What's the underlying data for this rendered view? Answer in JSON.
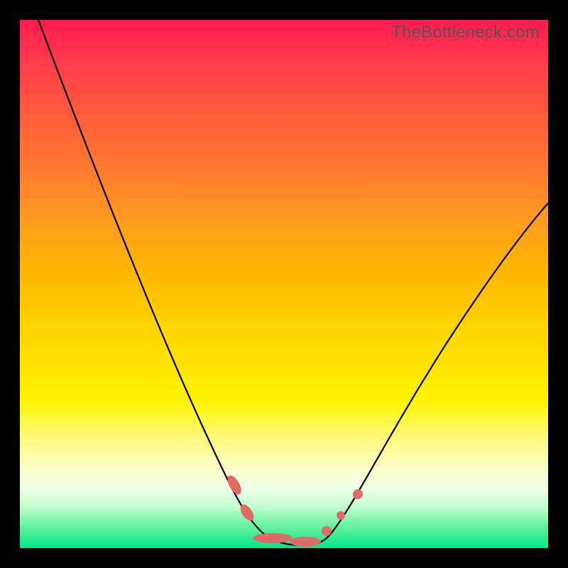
{
  "watermark": "TheBottleneck.com",
  "colors": {
    "frame_bg": "#000000",
    "gradient_top": "#ff1a4d",
    "gradient_mid": "#ffd400",
    "gradient_bottom": "#00e789",
    "curve_stroke": "#000000",
    "marker_fill": "#e06a66"
  },
  "chart_data": {
    "type": "line",
    "title": "",
    "xlabel": "",
    "ylabel": "",
    "xlim": [
      0,
      100
    ],
    "ylim": [
      0,
      100
    ],
    "grid": false,
    "x": [
      3,
      8,
      13,
      18,
      23,
      28,
      33,
      38,
      41,
      44,
      46,
      48,
      50,
      52,
      54,
      56,
      58,
      61,
      64,
      70,
      76,
      82,
      88,
      94,
      99
    ],
    "values": [
      100,
      88,
      76,
      64,
      52,
      40,
      28,
      17,
      11,
      6,
      3,
      1.5,
      1,
      1,
      1,
      1.5,
      3,
      6,
      10,
      20,
      30,
      40,
      49,
      58,
      65
    ],
    "markers": [
      {
        "x": 41,
        "y": 11,
        "shape": "pill-diag",
        "rx": 15,
        "ry": 6,
        "angle": 60
      },
      {
        "x": 44,
        "y": 6,
        "shape": "pill-diag",
        "rx": 13,
        "ry": 6,
        "angle": 55
      },
      {
        "x": 48,
        "y": 1.5,
        "shape": "pill-horiz",
        "rx": 28,
        "ry": 6,
        "angle": 0
      },
      {
        "x": 54,
        "y": 1,
        "shape": "pill-horiz",
        "rx": 22,
        "ry": 6,
        "angle": 0
      },
      {
        "x": 58,
        "y": 3,
        "shape": "dot",
        "rx": 7,
        "ry": 7,
        "angle": 0
      },
      {
        "x": 61,
        "y": 6,
        "shape": "dot",
        "rx": 6,
        "ry": 6,
        "angle": 0
      },
      {
        "x": 64,
        "y": 10,
        "shape": "dot",
        "rx": 7,
        "ry": 7,
        "angle": 0
      }
    ],
    "notes": "Values are estimated from pixel positions; y=0 bottom (green), y=100 top (red). The curve is a V / parabola-like bottleneck shape with minimum around x≈52."
  }
}
